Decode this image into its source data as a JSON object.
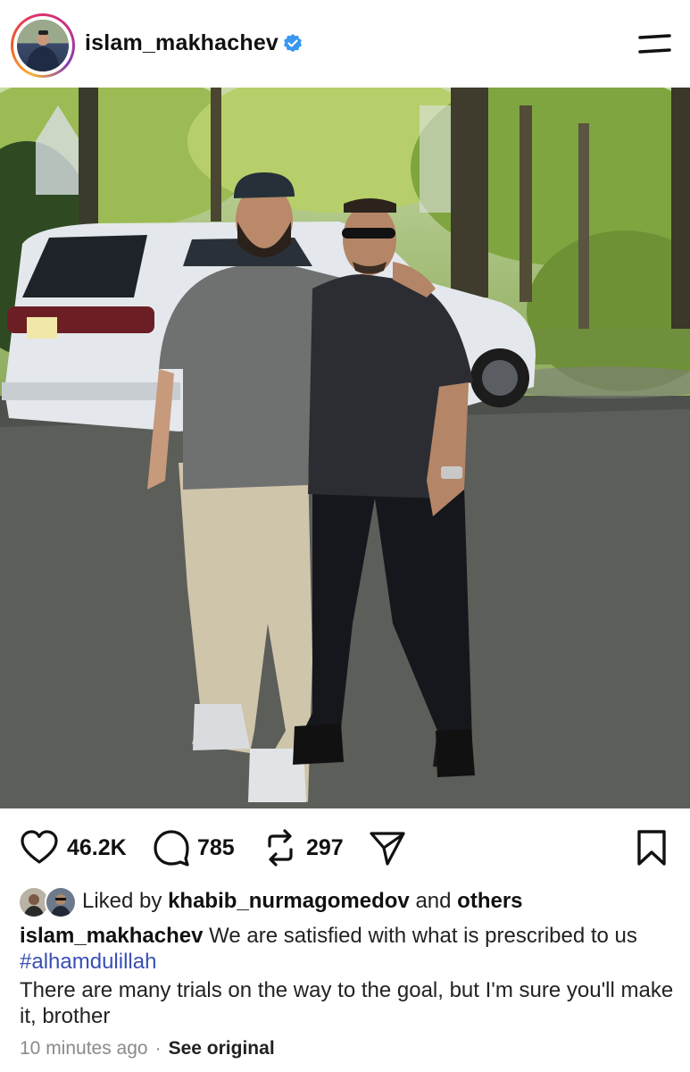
{
  "post": {
    "username": "islam_makhachev",
    "verified": true,
    "photo_alt": "",
    "stats": {
      "likes": "46.2K",
      "comments": "785",
      "reposts": "297"
    },
    "liked_by": {
      "prefix": "Liked by ",
      "user": "khabib_nurmagomedov",
      "middle": " and ",
      "suffix": "others"
    },
    "caption": {
      "author": "islam_makhachev",
      "text": " We are satisfied with what is prescribed to us ",
      "hashtag": "#alhamdulillah"
    },
    "comment_text": "There are many trials on the way to the goal, but I'm sure you'll make it, brother",
    "time": "10 minutes ago",
    "separator": "·",
    "see_original": "See original"
  },
  "icons": {
    "verified": "verified-badge-icon",
    "menu": "menu-icon",
    "like": "heart-icon",
    "comment": "comment-bubble-icon",
    "repost": "repost-icon",
    "share": "paper-plane-icon",
    "save": "bookmark-icon"
  },
  "colors": {
    "verified_blue": "#3897f0",
    "hashtag_blue": "#3a4fb5",
    "meta_gray": "#8a8a8a"
  }
}
